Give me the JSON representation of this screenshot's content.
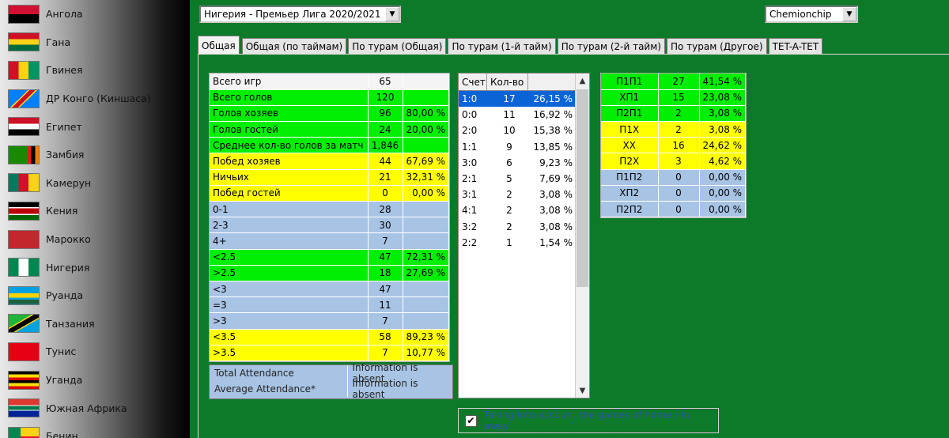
{
  "sidebar": {
    "countries": [
      {
        "name": "Ангола",
        "flag": "angola"
      },
      {
        "name": "Гана",
        "flag": "ghana"
      },
      {
        "name": "Гвинея",
        "flag": "guinea"
      },
      {
        "name": "ДР Конго (Киншаса)",
        "flag": "drc"
      },
      {
        "name": "Египет",
        "flag": "egypt"
      },
      {
        "name": "Замбия",
        "flag": "zambia"
      },
      {
        "name": "Камерун",
        "flag": "cameroon"
      },
      {
        "name": "Кения",
        "flag": "kenya"
      },
      {
        "name": "Марокко",
        "flag": "morocco"
      },
      {
        "name": "Нигерия",
        "flag": "nigeria"
      },
      {
        "name": "Руанда",
        "flag": "rwanda"
      },
      {
        "name": "Танзания",
        "flag": "tanzania"
      },
      {
        "name": "Тунис",
        "flag": "tunisia"
      },
      {
        "name": "Уганда",
        "flag": "uganda"
      },
      {
        "name": "Южная Африка",
        "flag": "south-africa"
      },
      {
        "name": "Бенин",
        "flag": "benin"
      }
    ]
  },
  "league_select": {
    "value": "Нигерия - Премьер Лига 2020/2021"
  },
  "type_select": {
    "value": "Chemionchip"
  },
  "tabs": [
    "Общая",
    "Общая (по таймам)",
    "По турам (Общая)",
    "По турам (1-й тайм)",
    "По турам (2-й тайм)",
    "По турам (Другое)",
    "TET-A-TET"
  ],
  "stats": [
    {
      "label": "Всего игр",
      "value": "65",
      "pct": "",
      "color": "w"
    },
    {
      "label": "Всего голов",
      "value": "120",
      "pct": "",
      "color": "g"
    },
    {
      "label": "Голов хозяев",
      "value": "96",
      "pct": "80,00 %",
      "color": "g"
    },
    {
      "label": "Голов гостей",
      "value": "24",
      "pct": "20,00 %",
      "color": "g"
    },
    {
      "label": "Среднее кол-во голов за матч",
      "value": "1,846",
      "pct": "",
      "color": "g"
    },
    {
      "label": "Побед хозяев",
      "value": "44",
      "pct": "67,69 %",
      "color": "y"
    },
    {
      "label": "Ничьих",
      "value": "21",
      "pct": "32,31 %",
      "color": "y"
    },
    {
      "label": "Побед гостей",
      "value": "0",
      "pct": "0,00 %",
      "color": "y"
    },
    {
      "label": "0-1",
      "value": "28",
      "pct": "",
      "color": "b"
    },
    {
      "label": "2-3",
      "value": "30",
      "pct": "",
      "color": "b"
    },
    {
      "label": "4+",
      "value": "7",
      "pct": "",
      "color": "b"
    },
    {
      "label": "<2.5",
      "value": "47",
      "pct": "72,31 %",
      "color": "g"
    },
    {
      "label": ">2.5",
      "value": "18",
      "pct": "27,69 %",
      "color": "g"
    },
    {
      "label": "<3",
      "value": "47",
      "pct": "",
      "color": "b"
    },
    {
      "label": "=3",
      "value": "11",
      "pct": "",
      "color": "b"
    },
    {
      "label": ">3",
      "value": "7",
      "pct": "",
      "color": "b"
    },
    {
      "label": "<3.5",
      "value": "58",
      "pct": "89,23 %",
      "color": "y"
    },
    {
      "label": ">3.5",
      "value": "7",
      "pct": "10,77 %",
      "color": "y"
    }
  ],
  "attendance": [
    {
      "label": "Total Attendance",
      "value": "Information is absent"
    },
    {
      "label": "Average Attendance*",
      "value": "Information is absent"
    }
  ],
  "scores": {
    "headers": [
      "Счет",
      "Кол-во"
    ],
    "rows": [
      {
        "score": "1:0",
        "count": "17",
        "pct": "26,15 %"
      },
      {
        "score": "0:0",
        "count": "11",
        "pct": "16,92 %"
      },
      {
        "score": "2:0",
        "count": "10",
        "pct": "15,38 %"
      },
      {
        "score": "1:1",
        "count": "9",
        "pct": "13,85 %"
      },
      {
        "score": "3:0",
        "count": "6",
        "pct": "9,23 %"
      },
      {
        "score": "2:1",
        "count": "5",
        "pct": "7,69 %"
      },
      {
        "score": "3:1",
        "count": "2",
        "pct": "3,08 %"
      },
      {
        "score": "4:1",
        "count": "2",
        "pct": "3,08 %"
      },
      {
        "score": "3:2",
        "count": "2",
        "pct": "3,08 %"
      },
      {
        "score": "2:2",
        "count": "1",
        "pct": "1,54 %"
      }
    ],
    "selected_index": 0
  },
  "outcomes": [
    {
      "label": "П1П1",
      "value": "27",
      "pct": "41,54 %",
      "color": "g"
    },
    {
      "label": "ХП1",
      "value": "15",
      "pct": "23,08 %",
      "color": "g"
    },
    {
      "label": "П2П1",
      "value": "2",
      "pct": "3,08 %",
      "color": "g"
    },
    {
      "label": "П1Х",
      "value": "2",
      "pct": "3,08 %",
      "color": "y"
    },
    {
      "label": "ХХ",
      "value": "16",
      "pct": "24,62 %",
      "color": "y"
    },
    {
      "label": "П2Х",
      "value": "3",
      "pct": "4,62 %",
      "color": "y"
    },
    {
      "label": "П1П2",
      "value": "0",
      "pct": "0,00 %",
      "color": "b"
    },
    {
      "label": "ХП2",
      "value": "0",
      "pct": "0,00 %",
      "color": "b"
    },
    {
      "label": "П2П2",
      "value": "0",
      "pct": "0,00 %",
      "color": "b"
    }
  ],
  "checkbox": {
    "label": "Taking into account the games of home / in away",
    "checked": "✔"
  },
  "icons": {
    "combo_arrow": "chevron-down-icon",
    "scroll_up": "chevron-up-icon",
    "scroll_down": "chevron-down-icon"
  }
}
